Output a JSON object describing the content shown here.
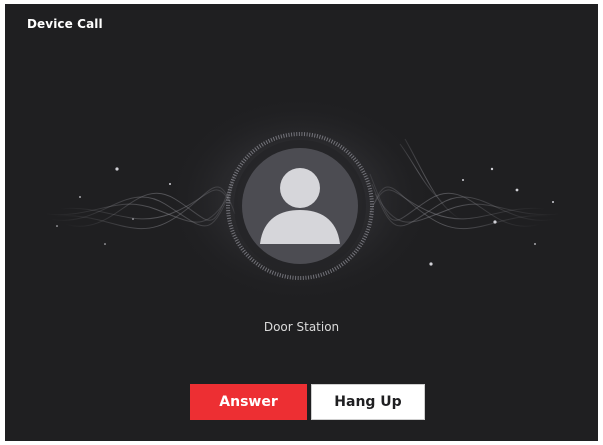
{
  "dialog": {
    "title": "Device Call"
  },
  "caller": {
    "name": "Door Station",
    "avatar_icon": "person-icon"
  },
  "buttons": {
    "answer_label": "Answer",
    "hangup_label": "Hang Up"
  },
  "colors": {
    "background": "#1f1f21",
    "answer": "#ed2f33",
    "hangup": "#ffffff",
    "avatar": "#5a5a60"
  }
}
